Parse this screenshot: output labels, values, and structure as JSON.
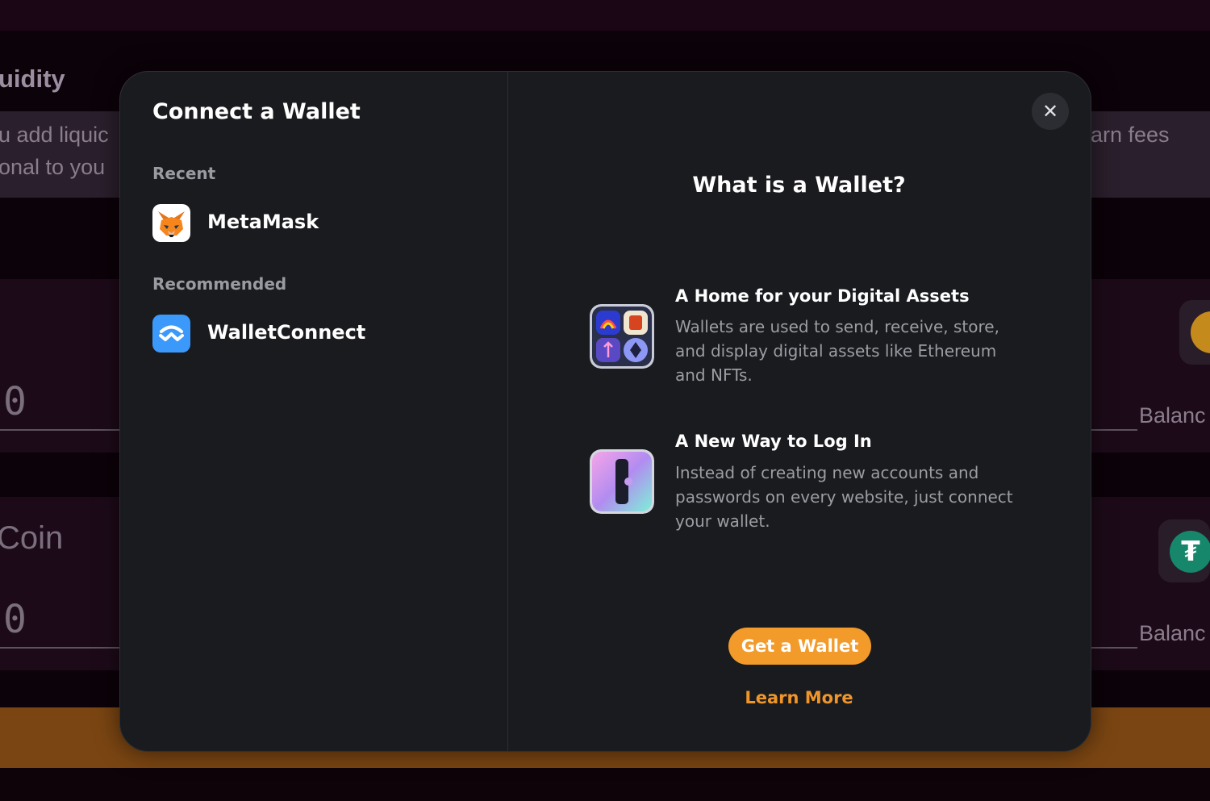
{
  "background": {
    "title": "uidity",
    "info_line1_left": "u add liquic",
    "info_line1_right": "arn fees",
    "info_line2_left": "onal to you",
    "zero1": "0",
    "zero2": "0",
    "coin_label": "Coin",
    "balance1": "Balanc",
    "balance2": "Balanc"
  },
  "modal": {
    "title": "Connect a Wallet",
    "close_symbol": "✕",
    "sections": [
      {
        "label": "Recent",
        "wallets": [
          {
            "name": "MetaMask",
            "icon": "metamask-fox-icon"
          }
        ]
      },
      {
        "label": "Recommended",
        "wallets": [
          {
            "name": "WalletConnect",
            "icon": "walletconnect-icon"
          }
        ]
      }
    ],
    "info": {
      "title": "What is a Wallet?",
      "features": [
        {
          "heading": "A Home for your Digital Assets",
          "description": "Wallets are used to send, receive, store, and display digital assets like Ethereum and NFTs.",
          "icon": "digital-assets-icon"
        },
        {
          "heading": "A New Way to Log In",
          "description": "Instead of creating new accounts and passwords on every website, just connect your wallet.",
          "icon": "login-key-icon"
        }
      ],
      "primary_button": "Get a Wallet",
      "secondary_link": "Learn More"
    }
  },
  "colors": {
    "accent": "#f39b2a",
    "modal_bg": "#1a1b1f",
    "page_bg": "#0c0209"
  }
}
